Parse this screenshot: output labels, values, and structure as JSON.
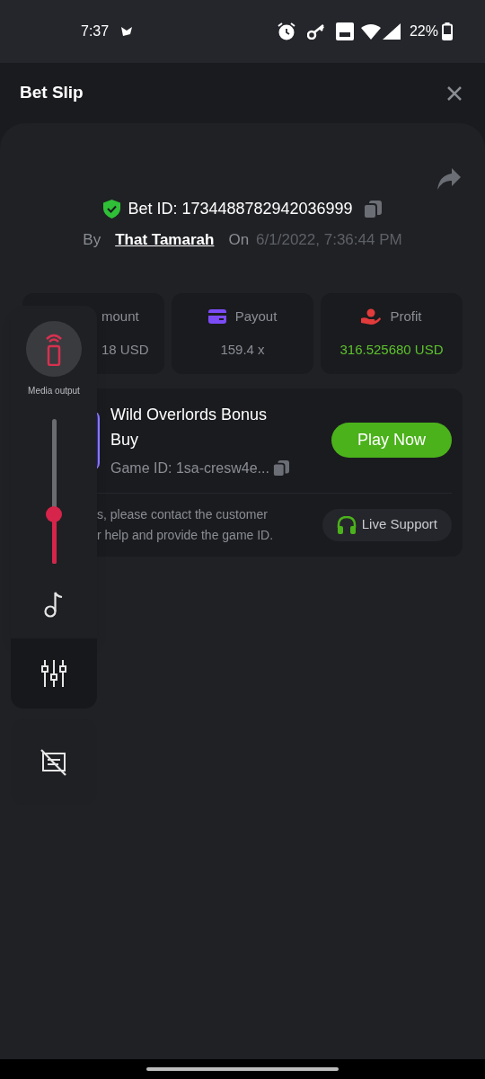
{
  "status_bar": {
    "time": "7:37",
    "battery": "22%"
  },
  "header": {
    "title": "Bet Slip"
  },
  "bet": {
    "id_text": "Bet ID: 1734488782942036999",
    "by_label": "By",
    "user": "That Tamarah",
    "on_label": "On",
    "date": "6/1/2022, 7:36:44 PM"
  },
  "stats": [
    {
      "kind": "amount",
      "label": "mount",
      "value": "18 USD",
      "positive": false
    },
    {
      "kind": "payout",
      "label": "Payout",
      "value": "159.4 x",
      "positive": false
    },
    {
      "kind": "profit",
      "label": "Profit",
      "value": "316.525680 USD",
      "positive": true
    }
  ],
  "game": {
    "title": "Wild Overlords Bonus Buy",
    "game_id": "Game ID: 1sa-cresw4e...",
    "play_button": "Play Now",
    "help_lines": [
      "s, please contact the customer",
      "r help and provide the game ID."
    ],
    "support_button": "Live Support"
  },
  "volume_panel": {
    "output_label": "Media output",
    "level": 0.34
  }
}
